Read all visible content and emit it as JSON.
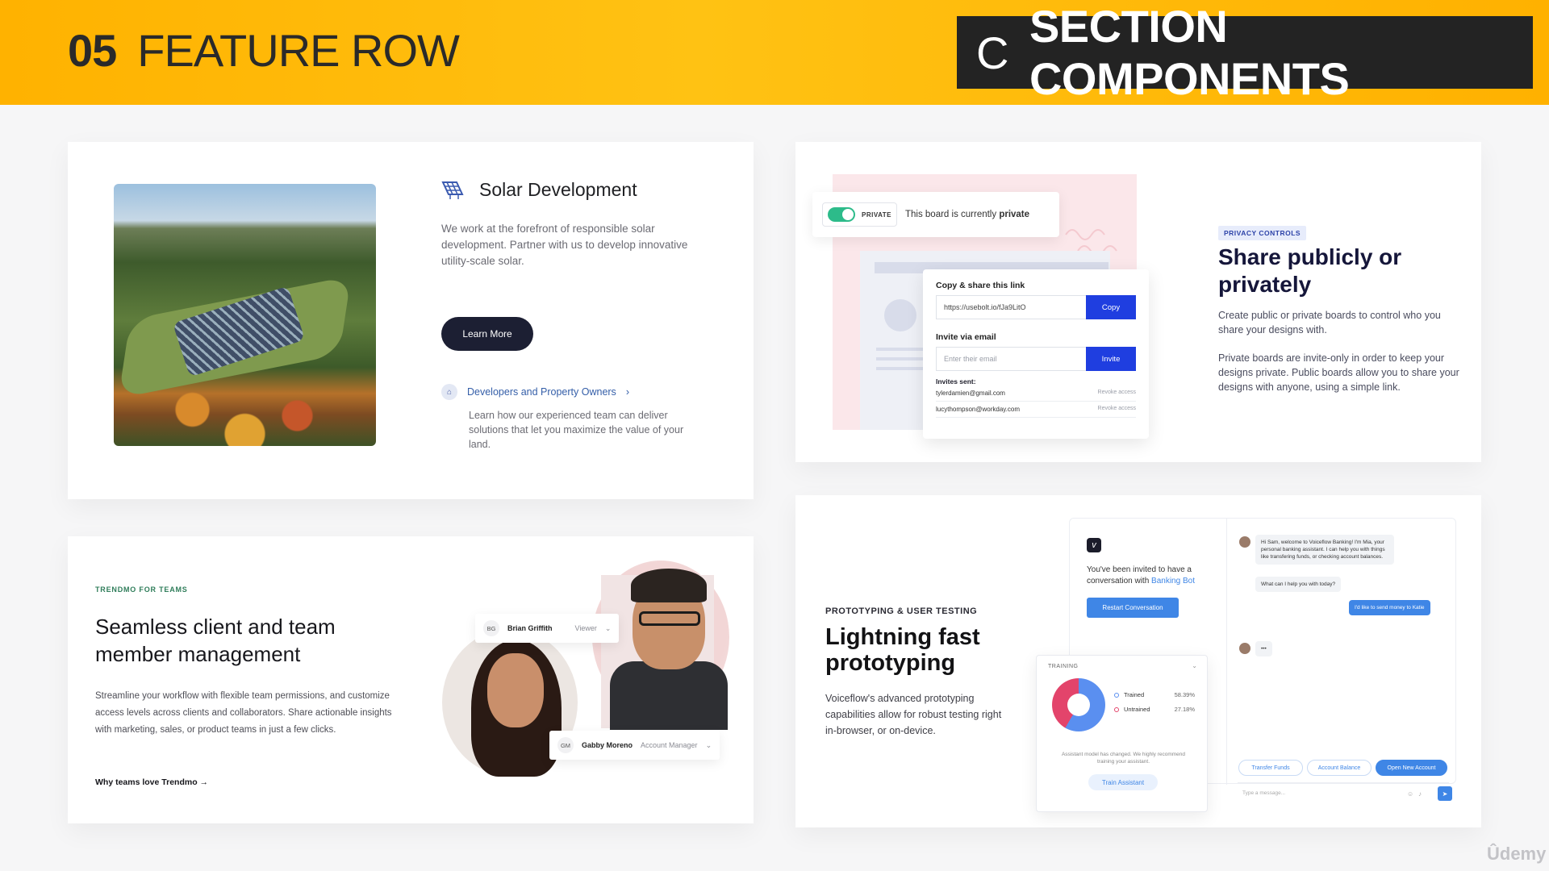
{
  "banner": {
    "number": "05",
    "title": "FEATURE ROW",
    "section_letter": "C",
    "section_title": "SECTION COMPONENTS"
  },
  "solar": {
    "title": "Solar Development",
    "icon": "solar-panel-icon",
    "description": "We work at the forefront of responsible solar development. Partner with us to develop innovative utility-scale solar.",
    "button_label": "Learn More",
    "link_label": "Developers and Property Owners",
    "link_description": "Learn how our experienced team can deliver solutions that let you maximize the value of your land."
  },
  "privacy": {
    "toggle_label": "PRIVATE",
    "status_prefix": "This board is currently",
    "status_value": "private",
    "share_heading": "Copy & share this link",
    "share_url": "https://usebolt.io/fJa9LitO",
    "copy_label": "Copy",
    "invite_heading": "Invite via email",
    "email_placeholder": "Enter their email",
    "invite_label": "Invite",
    "invites_sent_label": "Invites sent:",
    "invites": [
      {
        "email": "tylerdamien@gmail.com",
        "action": "Revoke access"
      },
      {
        "email": "lucythompson@workday.com",
        "action": "Revoke access"
      }
    ],
    "tag": "PRIVACY CONTROLS",
    "title": "Share publicly or privately",
    "paragraph1": "Create public or private boards to control who you share your designs with.",
    "paragraph2": "Private boards are invite-only in order to keep your designs private. Public boards allow you to share your designs with anyone, using a simple link."
  },
  "teams": {
    "eyebrow": "TRENDMO FOR TEAMS",
    "title": "Seamless client and team member management",
    "description": "Streamline your workflow with flexible team permissions, and customize access levels across clients and collaborators. Share actionable insights with marketing, sales, or product teams in just a few clicks.",
    "link": "Why teams love Trendmo →",
    "members": [
      {
        "initials": "BG",
        "name": "Brian Griffith",
        "role": "Viewer"
      },
      {
        "initials": "GM",
        "name": "Gabby Moreno",
        "role": "Account Manager"
      }
    ]
  },
  "proto": {
    "eyebrow": "PROTOTYPING & USER TESTING",
    "title": "Lightning fast prototyping",
    "description": "Voiceflow's advanced prototyping capabilities allow for robust testing right in-browser, or on-device.",
    "invite_text": "You've been invited to have a conversation with",
    "bot_name": "Banking Bot",
    "restart_label": "Restart Conversation",
    "bot_greeting": "Hi Sam, welcome to Voiceflow Banking! I'm Mia, your personal banking assistant. I can help you with things like transfering funds, or checking account balances.",
    "bot_question": "What can I help you with today?",
    "user_reply": "I'd like to send money to Katie",
    "typing": "•••",
    "quick_replies": [
      "Transfer Funds",
      "Account Balance",
      "Open New Account"
    ],
    "input_placeholder": "Type a message...",
    "training": {
      "label": "TRAINING",
      "trained_label": "Trained",
      "trained_pct": "58.39%",
      "untrained_label": "Untrained",
      "untrained_pct": "27.18%",
      "message": "Assistant model has changed. We highly recommend training your assistant.",
      "button": "Train Assistant"
    }
  },
  "watermark": "Ûdemy"
}
